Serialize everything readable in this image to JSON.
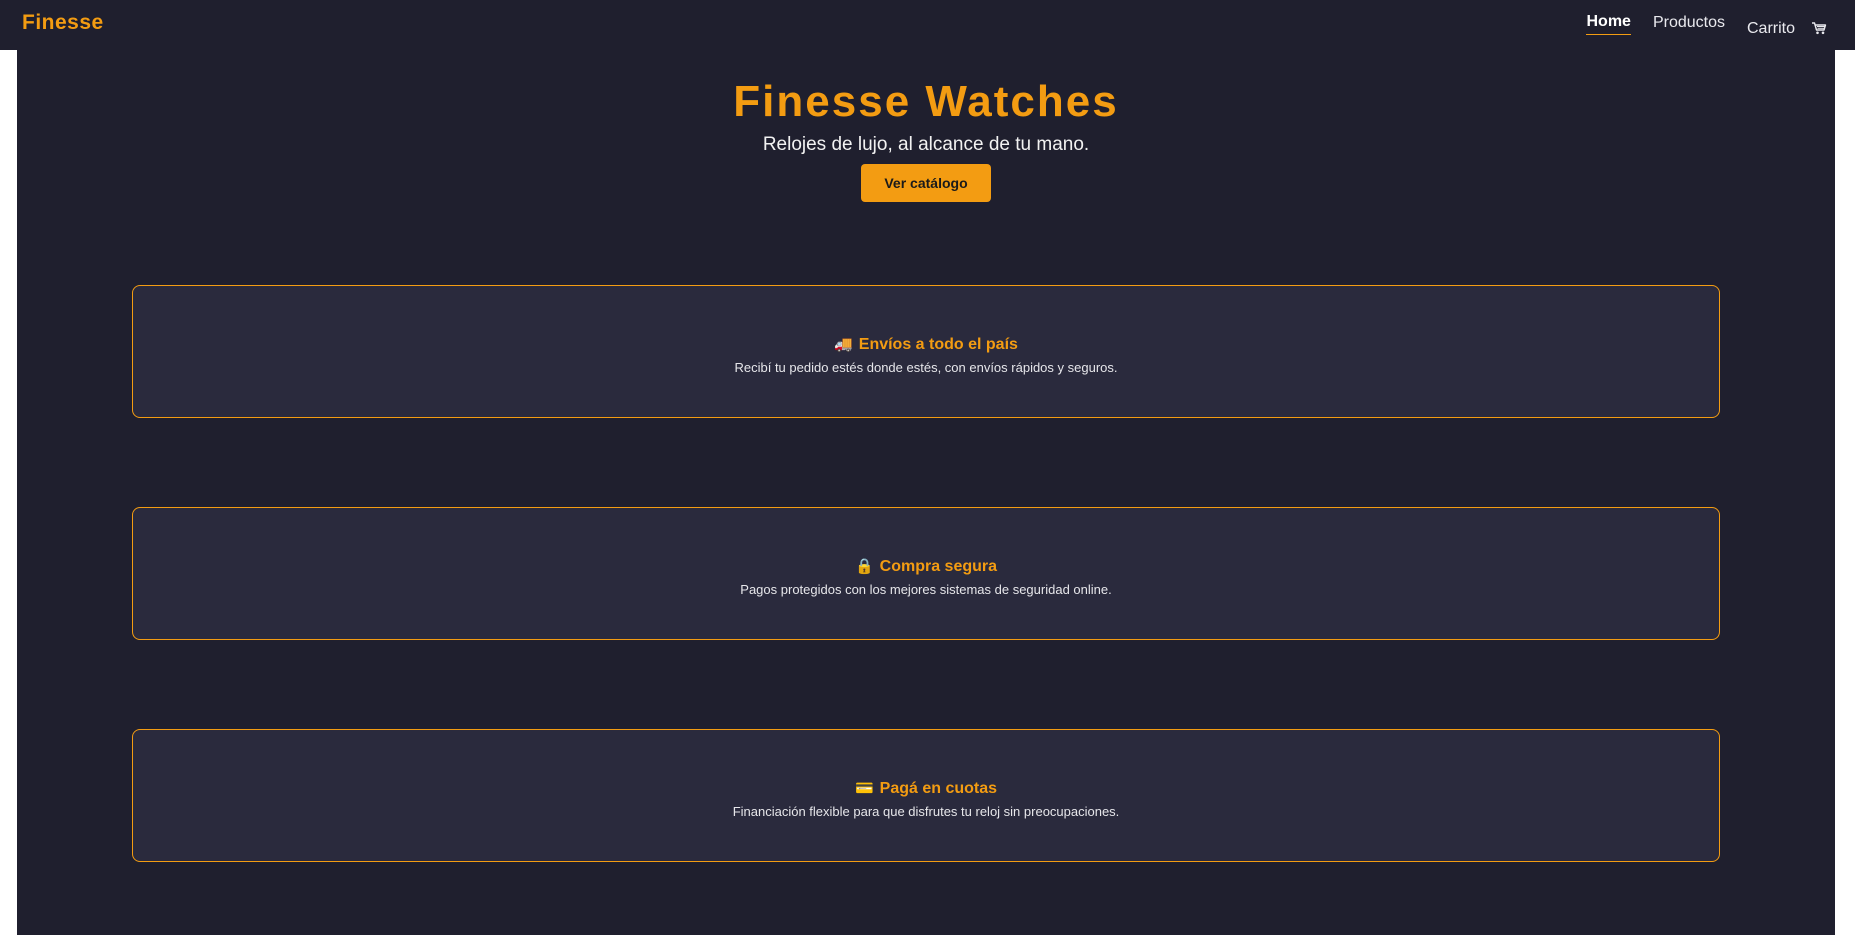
{
  "navbar": {
    "brand": "Finesse",
    "links": {
      "home": "Home",
      "products": "Productos",
      "cart": "Carrito"
    }
  },
  "hero": {
    "title": "Finesse Watches",
    "subtitle": "Relojes de lujo, al alcance de tu mano.",
    "cta_label": "Ver catálogo"
  },
  "features": [
    {
      "icon": "truck-icon",
      "emoji": "🚚",
      "title": "Envíos a todo el país",
      "description": "Recibí tu pedido estés donde estés, con envíos rápidos y seguros."
    },
    {
      "icon": "lock-icon",
      "emoji": "🔒",
      "title": "Compra segura",
      "description": "Pagos protegidos con los mejores sistemas de seguridad online."
    },
    {
      "icon": "credit-card-icon",
      "emoji": "💳",
      "title": "Pagá en cuotas",
      "description": "Financiación flexible para que disfrutes tu reloj sin preocupaciones."
    }
  ],
  "colors": {
    "accent": "#f39c12",
    "background": "#1f1f2e",
    "card": "#2a2a3d",
    "text": "#f2f2f2"
  }
}
